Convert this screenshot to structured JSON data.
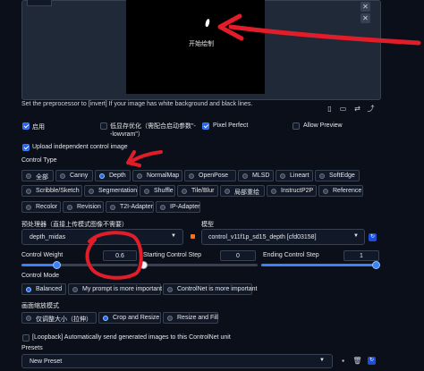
{
  "canvas": {
    "overlay_text": "开始绘制"
  },
  "top_toolbar_icons": [
    "close-icon",
    "close-icon"
  ],
  "preprocessor_hint": "Set the preprocessor to [invert] If your image has white background and black lines.",
  "image_toolbar_icons": [
    "document-icon",
    "sketch-icon",
    "swap-icon",
    "upload-icon"
  ],
  "options": {
    "enable": {
      "label": "启用",
      "checked": true
    },
    "low_vram": {
      "label": "低显存优化（需配合启动参数\"--lowvram\"）",
      "checked": false
    },
    "pixel_perfect": {
      "label": "Pixel Perfect",
      "checked": true
    },
    "allow_preview": {
      "label": "Allow Preview",
      "checked": false
    }
  },
  "upload_independent": {
    "label": "Upload independent control image",
    "checked": true
  },
  "control_type": {
    "label": "Control Type",
    "selected": "Depth",
    "options": [
      "全部",
      "Canny",
      "Depth",
      "NormalMap",
      "OpenPose",
      "MLSD",
      "Lineart",
      "SoftEdge",
      "Scribble/Sketch",
      "Segmentation",
      "Shuffle",
      "Tile/Blur",
      "局部重绘",
      "InstructP2P",
      "Reference",
      "Recolor",
      "Revision",
      "T2I-Adapter",
      "IP-Adapter"
    ]
  },
  "preprocessor": {
    "label": "预处理器（直接上传模式图像不需要）",
    "value": "depth_midas"
  },
  "model": {
    "label": "模型",
    "value": "control_v11f1p_sd15_depth [cfd03158]"
  },
  "sliders": {
    "control_weight": {
      "label": "Control Weight",
      "value": "0.6",
      "fraction": 0.3
    },
    "starting_step": {
      "label": "Starting Control Step",
      "value": "0",
      "fraction": 0.0
    },
    "ending_step": {
      "label": "Ending Control Step",
      "value": "1",
      "fraction": 1.0
    }
  },
  "control_mode": {
    "label": "Control Mode",
    "selected": "Balanced",
    "options": [
      "Balanced",
      "My prompt is more important",
      "ControlNet is more important"
    ]
  },
  "resize_mode": {
    "label": "画面缩放模式",
    "selected": "Crop and Resize",
    "options": [
      "仅调整大小（拉伸）",
      "Crop and Resize",
      "Resize and Fill"
    ]
  },
  "loopback": {
    "label": "[Loopback] Automatically send generated images to this ControlNet unit",
    "checked": false
  },
  "presets": {
    "label": "Presets",
    "value": "New Preset"
  },
  "colors": {
    "accent": "#2563eb",
    "background": "#0b0f19",
    "panel": "#1f2937",
    "annotation": "#e11d2a"
  }
}
